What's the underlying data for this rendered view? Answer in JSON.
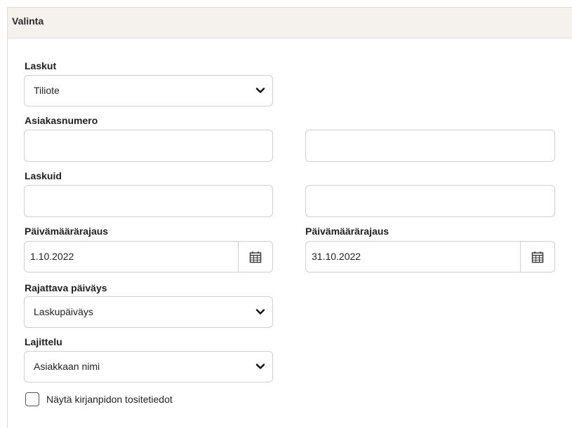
{
  "section": {
    "title": "Valinta"
  },
  "fields": {
    "laskut": {
      "label": "Laskut",
      "value": "Tiliote"
    },
    "asiakasnumero": {
      "label": "Asiakasnumero",
      "from": "",
      "to": ""
    },
    "laskuid": {
      "label": "Laskuid",
      "from": "",
      "to": ""
    },
    "paivamaara_alku": {
      "label": "Päivämäärärajaus",
      "value": "1.10.2022"
    },
    "paivamaara_loppu": {
      "label": "Päivämäärärajaus",
      "value": "31.10.2022"
    },
    "rajattava_paivays": {
      "label": "Rajattava päiväys",
      "value": "Laskupäiväys"
    },
    "lajittelu": {
      "label": "Lajittelu",
      "value": "Asiakkaan nimi"
    }
  },
  "checkbox": {
    "label": "Näytä kirjanpidon tositetiedot",
    "checked": false
  },
  "icons": {
    "dropdown": "chevron-down-icon",
    "date_picker": "calendar-icon"
  },
  "colors": {
    "header_bg": "#f5f2ee",
    "border": "#cfcfcf"
  }
}
